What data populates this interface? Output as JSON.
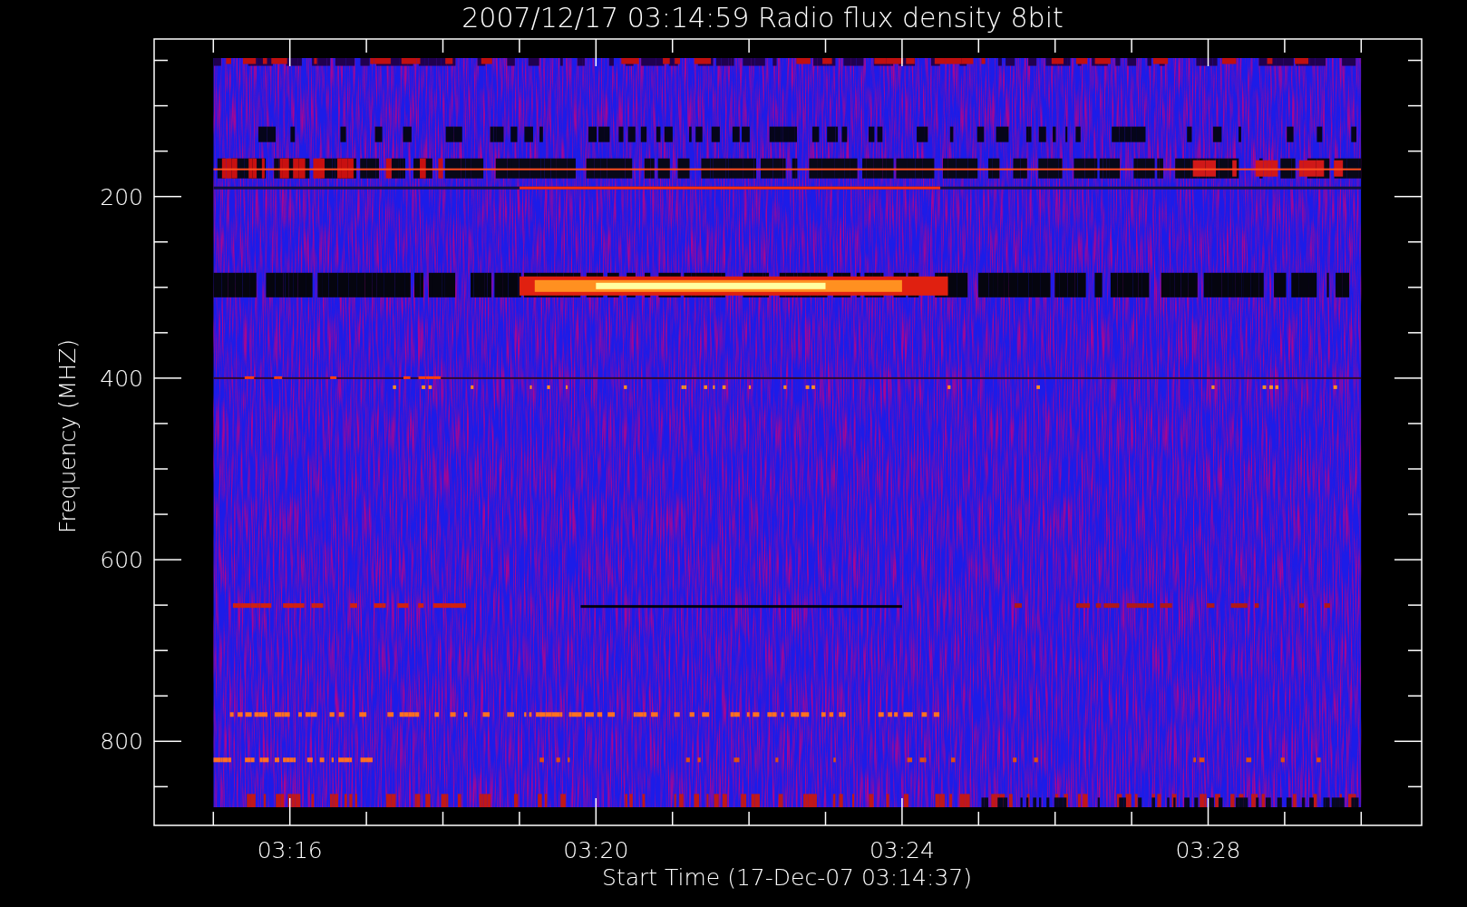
{
  "plot": {
    "title": "2007/12/17 03:14:59 Radio flux density 8bit",
    "y_axis": {
      "label": "Frequency (MHZ)",
      "ticks": [
        "200",
        "400",
        "600",
        "800"
      ]
    },
    "x_axis": {
      "label": "Start Time (17-Dec-07 03:14:37)",
      "ticks": [
        "03:16",
        "03:20",
        "03:24",
        "03:28"
      ]
    }
  }
}
